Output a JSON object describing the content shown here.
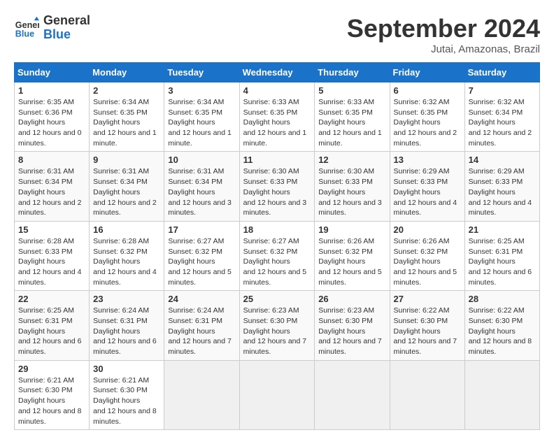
{
  "header": {
    "logo_line1": "General",
    "logo_line2": "Blue",
    "month_title": "September 2024",
    "subtitle": "Jutai, Amazonas, Brazil"
  },
  "weekdays": [
    "Sunday",
    "Monday",
    "Tuesday",
    "Wednesday",
    "Thursday",
    "Friday",
    "Saturday"
  ],
  "weeks": [
    [
      {
        "day": "1",
        "sunrise": "6:35 AM",
        "sunset": "6:36 PM",
        "daylight": "12 hours and 0 minutes."
      },
      {
        "day": "2",
        "sunrise": "6:34 AM",
        "sunset": "6:35 PM",
        "daylight": "12 hours and 1 minute."
      },
      {
        "day": "3",
        "sunrise": "6:34 AM",
        "sunset": "6:35 PM",
        "daylight": "12 hours and 1 minute."
      },
      {
        "day": "4",
        "sunrise": "6:33 AM",
        "sunset": "6:35 PM",
        "daylight": "12 hours and 1 minute."
      },
      {
        "day": "5",
        "sunrise": "6:33 AM",
        "sunset": "6:35 PM",
        "daylight": "12 hours and 1 minute."
      },
      {
        "day": "6",
        "sunrise": "6:32 AM",
        "sunset": "6:35 PM",
        "daylight": "12 hours and 2 minutes."
      },
      {
        "day": "7",
        "sunrise": "6:32 AM",
        "sunset": "6:34 PM",
        "daylight": "12 hours and 2 minutes."
      }
    ],
    [
      {
        "day": "8",
        "sunrise": "6:31 AM",
        "sunset": "6:34 PM",
        "daylight": "12 hours and 2 minutes."
      },
      {
        "day": "9",
        "sunrise": "6:31 AM",
        "sunset": "6:34 PM",
        "daylight": "12 hours and 2 minutes."
      },
      {
        "day": "10",
        "sunrise": "6:31 AM",
        "sunset": "6:34 PM",
        "daylight": "12 hours and 3 minutes."
      },
      {
        "day": "11",
        "sunrise": "6:30 AM",
        "sunset": "6:33 PM",
        "daylight": "12 hours and 3 minutes."
      },
      {
        "day": "12",
        "sunrise": "6:30 AM",
        "sunset": "6:33 PM",
        "daylight": "12 hours and 3 minutes."
      },
      {
        "day": "13",
        "sunrise": "6:29 AM",
        "sunset": "6:33 PM",
        "daylight": "12 hours and 4 minutes."
      },
      {
        "day": "14",
        "sunrise": "6:29 AM",
        "sunset": "6:33 PM",
        "daylight": "12 hours and 4 minutes."
      }
    ],
    [
      {
        "day": "15",
        "sunrise": "6:28 AM",
        "sunset": "6:33 PM",
        "daylight": "12 hours and 4 minutes."
      },
      {
        "day": "16",
        "sunrise": "6:28 AM",
        "sunset": "6:32 PM",
        "daylight": "12 hours and 4 minutes."
      },
      {
        "day": "17",
        "sunrise": "6:27 AM",
        "sunset": "6:32 PM",
        "daylight": "12 hours and 5 minutes."
      },
      {
        "day": "18",
        "sunrise": "6:27 AM",
        "sunset": "6:32 PM",
        "daylight": "12 hours and 5 minutes."
      },
      {
        "day": "19",
        "sunrise": "6:26 AM",
        "sunset": "6:32 PM",
        "daylight": "12 hours and 5 minutes."
      },
      {
        "day": "20",
        "sunrise": "6:26 AM",
        "sunset": "6:32 PM",
        "daylight": "12 hours and 5 minutes."
      },
      {
        "day": "21",
        "sunrise": "6:25 AM",
        "sunset": "6:31 PM",
        "daylight": "12 hours and 6 minutes."
      }
    ],
    [
      {
        "day": "22",
        "sunrise": "6:25 AM",
        "sunset": "6:31 PM",
        "daylight": "12 hours and 6 minutes."
      },
      {
        "day": "23",
        "sunrise": "6:24 AM",
        "sunset": "6:31 PM",
        "daylight": "12 hours and 6 minutes."
      },
      {
        "day": "24",
        "sunrise": "6:24 AM",
        "sunset": "6:31 PM",
        "daylight": "12 hours and 7 minutes."
      },
      {
        "day": "25",
        "sunrise": "6:23 AM",
        "sunset": "6:30 PM",
        "daylight": "12 hours and 7 minutes."
      },
      {
        "day": "26",
        "sunrise": "6:23 AM",
        "sunset": "6:30 PM",
        "daylight": "12 hours and 7 minutes."
      },
      {
        "day": "27",
        "sunrise": "6:22 AM",
        "sunset": "6:30 PM",
        "daylight": "12 hours and 7 minutes."
      },
      {
        "day": "28",
        "sunrise": "6:22 AM",
        "sunset": "6:30 PM",
        "daylight": "12 hours and 8 minutes."
      }
    ],
    [
      {
        "day": "29",
        "sunrise": "6:21 AM",
        "sunset": "6:30 PM",
        "daylight": "12 hours and 8 minutes."
      },
      {
        "day": "30",
        "sunrise": "6:21 AM",
        "sunset": "6:30 PM",
        "daylight": "12 hours and 8 minutes."
      },
      null,
      null,
      null,
      null,
      null
    ]
  ]
}
